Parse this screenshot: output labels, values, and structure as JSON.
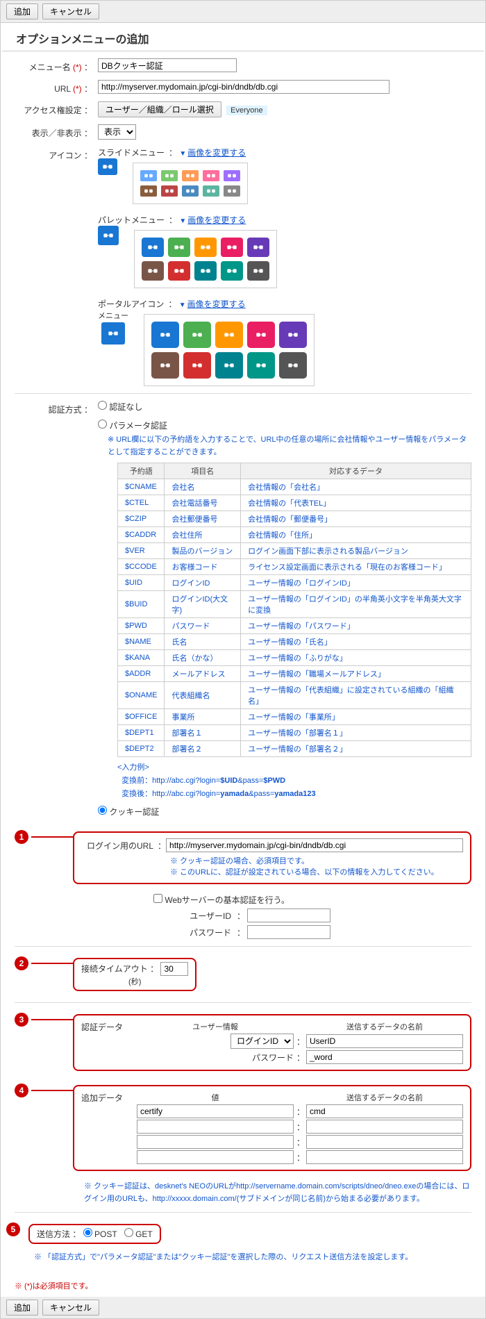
{
  "toolbar": {
    "add": "追加",
    "cancel": "キャンセル"
  },
  "title": "オプションメニューの追加",
  "menu_name": {
    "label": "メニュー名",
    "value": "DBクッキー認証"
  },
  "url": {
    "label": "URL",
    "value": "http://myserver.mydomain.jp/cgi-bin/dndb/db.cgi"
  },
  "access": {
    "label": "アクセス権設定",
    "button": "ユーザー／組織／ロール選択",
    "tag": "Everyone"
  },
  "visibility": {
    "label": "表示／非表示",
    "selected": "表示"
  },
  "icon_section": {
    "label": "アイコン",
    "slide": {
      "label": "スライドメニュー",
      "change": "画像を変更する"
    },
    "palette": {
      "label": "パレットメニュー",
      "change": "画像を変更する"
    },
    "portal": {
      "label": "ポータルアイコン",
      "label2": "メニュー",
      "change": "画像を変更する"
    },
    "slide_colors": [
      "#67a9ff",
      "#7bc96f",
      "#ff9b56",
      "#ff6e9c",
      "#9e6eff",
      "#8a5d3b",
      "#bb4444",
      "#4a8abf",
      "#5bb5a0",
      "#888"
    ],
    "palette_colors": [
      "#1976d2",
      "#4caf50",
      "#ff9800",
      "#e91e63",
      "#673ab7",
      "#795548",
      "#d32f2f",
      "#00838f",
      "#009688",
      "#555"
    ],
    "portal_colors": [
      "#1976d2",
      "#4caf50",
      "#ff9800",
      "#e91e63",
      "#673ab7",
      "#795548",
      "#d32f2f",
      "#00838f",
      "#009688",
      "#555"
    ]
  },
  "auth": {
    "label": "認証方式",
    "none": "認証なし",
    "param": "パラメータ認証",
    "param_note": "※ URL欄に以下の予約語を入力することで、URL中の任意の場所に会社情報やユーザー情報をパラメータとして指定することができます。",
    "table_head": [
      "予約語",
      "項目名",
      "対応するデータ"
    ],
    "rows": [
      [
        "$CNAME",
        "会社名",
        "会社情報の「会社名」"
      ],
      [
        "$CTEL",
        "会社電話番号",
        "会社情報の「代表TEL」"
      ],
      [
        "$CZIP",
        "会社郵便番号",
        "会社情報の「郵便番号」"
      ],
      [
        "$CADDR",
        "会社住所",
        "会社情報の「住所」"
      ],
      [
        "$VER",
        "製品のバージョン",
        "ログイン画面下部に表示される製品バージョン"
      ],
      [
        "$CCODE",
        "お客様コード",
        "ライセンス設定画面に表示される「現在のお客様コード」"
      ],
      [
        "$UID",
        "ログインID",
        "ユーザー情報の「ログインID」"
      ],
      [
        "$BUID",
        "ログインID(大文字)",
        "ユーザー情報の「ログインID」の半角英小文字を半角英大文字に変換"
      ],
      [
        "$PWD",
        "パスワード",
        "ユーザー情報の「パスワード」"
      ],
      [
        "$NAME",
        "氏名",
        "ユーザー情報の「氏名」"
      ],
      [
        "$KANA",
        "氏名（かな）",
        "ユーザー情報の「ふりがな」"
      ],
      [
        "$ADDR",
        "メールアドレス",
        "ユーザー情報の「職場メールアドレス」"
      ],
      [
        "$ONAME",
        "代表組織名",
        "ユーザー情報の「代表組織」に設定されている組織の「組織名」"
      ],
      [
        "$OFFICE",
        "事業所",
        "ユーザー情報の「事業所」"
      ],
      [
        "$DEPT1",
        "部署名１",
        "ユーザー情報の「部署名１」"
      ],
      [
        "$DEPT2",
        "部署名２",
        "ユーザー情報の「部署名２」"
      ]
    ],
    "example_hdr": "<入力例>",
    "example1_lbl": "変換前：",
    "example1": "http://abc.cgi?login=$UID&pass=$PWD",
    "example2_lbl": "変換後：",
    "example2": "http://abc.cgi?login=yamada&pass=yamada123",
    "cookie": "クッキー認証"
  },
  "cookie_cfg": {
    "login_url": {
      "label": "ログイン用のURL",
      "value": "http://myserver.mydomain.jp/cgi-bin/dndb/db.cgi",
      "note1": "※ クッキー認証の場合、必須項目です。",
      "note2": "※ このURLに、認証が設定されている場合、以下の情報を入力してください。"
    },
    "basic_auth": {
      "checkbox": "Webサーバーの基本認証を行う。",
      "userid": "ユーザーID",
      "password": "パスワード"
    },
    "timeout": {
      "label": "接続タイムアウト",
      "unit": "(秒)",
      "value": "30"
    },
    "auth_data": {
      "label": "認証データ",
      "hdr1": "ユーザー情報",
      "hdr2": "送信するデータの名前",
      "row1_sel": "ログインID",
      "row1_val": "UserID",
      "row2_lbl": "パスワード",
      "row2_val": "_word"
    },
    "extra_data": {
      "label": "追加データ",
      "hdr1": "値",
      "hdr2": "送信するデータの名前",
      "row1_v": "certify",
      "row1_n": "cmd"
    },
    "note": "※ クッキー認証は、desknet's NEOのURLがhttp://servername.domain.com/scripts/dneo/dneo.exeの場合には、ログイン用のURLも、http://xxxxx.domain.com/(サブドメインが同じ名前)から始まる必要があります。"
  },
  "send": {
    "label": "送信方法",
    "post": "POST",
    "get": "GET",
    "note": "※ 「認証方式」で\"パラメータ認証\"または\"クッキー認証\"を選択した際の、リクエスト送信方法を設定します。"
  },
  "required_note": "※ (*)は必須項目です。"
}
